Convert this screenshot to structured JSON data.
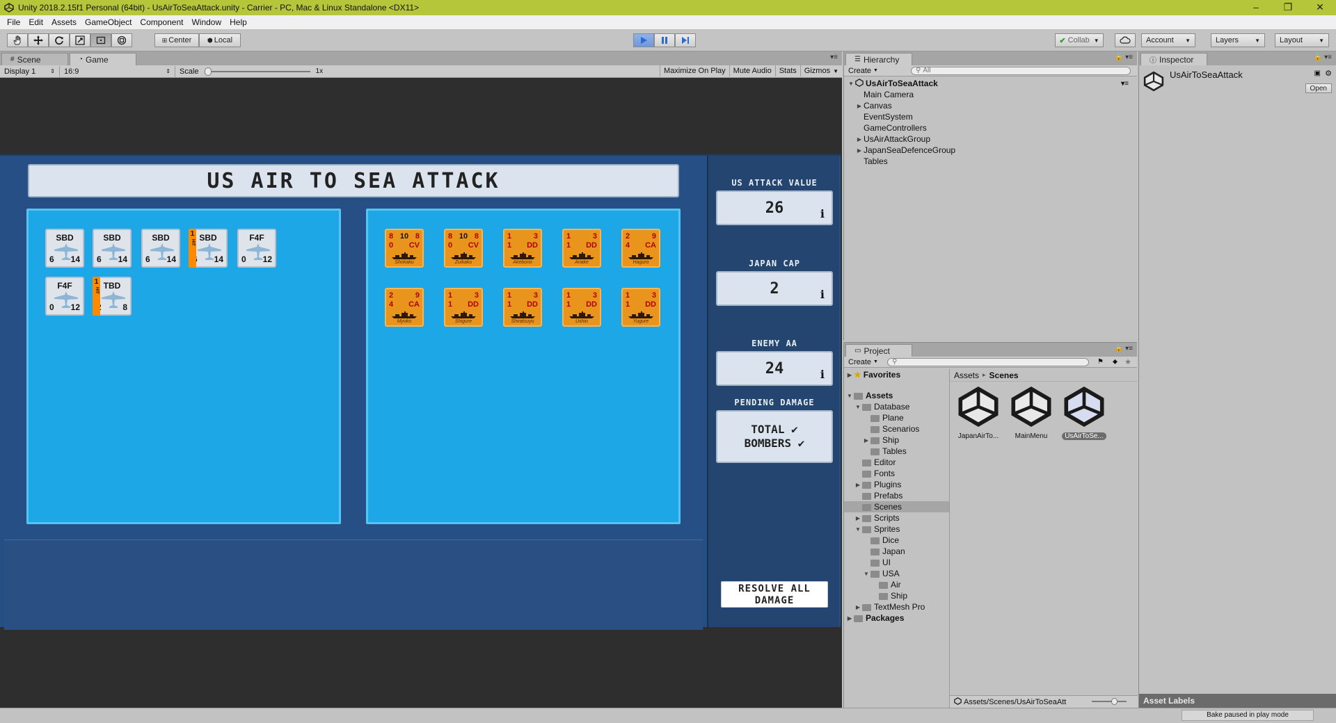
{
  "window": {
    "title": "Unity 2018.2.15f1 Personal (64bit) - UsAirToSeaAttack.unity - Carrier - PC, Mac & Linux Standalone <DX11>",
    "minimize": "–",
    "maximize": "❐",
    "close": "✕"
  },
  "menu": [
    "File",
    "Edit",
    "Assets",
    "GameObject",
    "Component",
    "Window",
    "Help"
  ],
  "toolbar": {
    "pivot": "Center",
    "space": "Local",
    "collab": "Collab",
    "account": "Account",
    "layers": "Layers",
    "layout": "Layout",
    "playing": true
  },
  "scene_tab": "Scene",
  "game_tab": "Game",
  "gamebar": {
    "display": "Display 1",
    "aspect": "16:9",
    "scale_label": "Scale",
    "scale_value": "1x",
    "maximize_on_play": "Maximize On Play",
    "mute_audio": "Mute Audio",
    "stats": "Stats",
    "gizmos": "Gizmos"
  },
  "game": {
    "title": "US AIR TO SEA ATTACK",
    "us_units": [
      {
        "type": "SBD",
        "left": "6",
        "right": "14",
        "hit": ""
      },
      {
        "type": "SBD",
        "left": "6",
        "right": "14",
        "hit": ""
      },
      {
        "type": "SBD",
        "left": "6",
        "right": "14",
        "hit": ""
      },
      {
        "type": "SBD",
        "left": "6",
        "right": "14",
        "hit": "1"
      },
      {
        "type": "F4F",
        "left": "0",
        "right": "12",
        "hit": ""
      },
      {
        "type": "F4F",
        "left": "0",
        "right": "12",
        "hit": ""
      },
      {
        "type": "TBD",
        "left": "2",
        "right": "8",
        "hit": "1"
      }
    ],
    "hit_word": "HIT",
    "japan_units": [
      {
        "a": "8",
        "b": "10",
        "c": "8",
        "d": "0",
        "cls": "CV",
        "name": "Shokaku"
      },
      {
        "a": "8",
        "b": "10",
        "c": "8",
        "d": "0",
        "cls": "CV",
        "name": "Zuikaku"
      },
      {
        "a": "1",
        "b": "",
        "c": "3",
        "d": "1",
        "cls": "DD",
        "name": "Akebono"
      },
      {
        "a": "1",
        "b": "",
        "c": "3",
        "d": "1",
        "cls": "DD",
        "name": "Ariake"
      },
      {
        "a": "2",
        "b": "",
        "c": "9",
        "d": "4",
        "cls": "CA",
        "name": "Haguro"
      },
      {
        "a": "2",
        "b": "",
        "c": "9",
        "d": "4",
        "cls": "CA",
        "name": "Myoko"
      },
      {
        "a": "1",
        "b": "",
        "c": "3",
        "d": "1",
        "cls": "DD",
        "name": "Shigure"
      },
      {
        "a": "1",
        "b": "",
        "c": "3",
        "d": "1",
        "cls": "DD",
        "name": "Shiratsuyu"
      },
      {
        "a": "1",
        "b": "",
        "c": "3",
        "d": "1",
        "cls": "DD",
        "name": "Ushio"
      },
      {
        "a": "1",
        "b": "",
        "c": "3",
        "d": "1",
        "cls": "DD",
        "name": "Yugure"
      }
    ],
    "side": {
      "us_attack_label": "US ATTACK VALUE",
      "us_attack_value": "26",
      "japan_cap_label": "JAPAN CAP",
      "japan_cap_value": "2",
      "enemy_aa_label": "ENEMY AA",
      "enemy_aa_value": "24",
      "pending_label": "PENDING DAMAGE",
      "pending_line1": "TOTAL ✔",
      "pending_line2": "BOMBERS ✔",
      "info_glyph": "i",
      "resolve_line1": "RESOLVE ALL",
      "resolve_line2": "DAMAGE"
    }
  },
  "hierarchy": {
    "tab": "Hierarchy",
    "create": "Create",
    "search_placeholder": "All",
    "scene": "UsAirToSeaAttack",
    "items": [
      {
        "label": "Main Camera",
        "expandable": false
      },
      {
        "label": "Canvas",
        "expandable": true
      },
      {
        "label": "EventSystem",
        "expandable": false
      },
      {
        "label": "GameControllers",
        "expandable": false
      },
      {
        "label": "UsAirAttackGroup",
        "expandable": true
      },
      {
        "label": "JapanSeaDefenceGroup",
        "expandable": true
      },
      {
        "label": "Tables",
        "expandable": false
      }
    ]
  },
  "project": {
    "tab": "Project",
    "create": "Create",
    "favorites": "Favorites",
    "assets_root": "Assets",
    "tree": [
      {
        "label": "Database",
        "depth": 1,
        "tri": "open"
      },
      {
        "label": "Plane",
        "depth": 2,
        "tri": ""
      },
      {
        "label": "Scenarios",
        "depth": 2,
        "tri": ""
      },
      {
        "label": "Ship",
        "depth": 2,
        "tri": "closed"
      },
      {
        "label": "Tables",
        "depth": 2,
        "tri": ""
      },
      {
        "label": "Editor",
        "depth": 1,
        "tri": ""
      },
      {
        "label": "Fonts",
        "depth": 1,
        "tri": ""
      },
      {
        "label": "Plugins",
        "depth": 1,
        "tri": "closed"
      },
      {
        "label": "Prefabs",
        "depth": 1,
        "tri": ""
      },
      {
        "label": "Scenes",
        "depth": 1,
        "tri": "",
        "selected": true
      },
      {
        "label": "Scripts",
        "depth": 1,
        "tri": "closed"
      },
      {
        "label": "Sprites",
        "depth": 1,
        "tri": "open"
      },
      {
        "label": "Dice",
        "depth": 2,
        "tri": ""
      },
      {
        "label": "Japan",
        "depth": 2,
        "tri": ""
      },
      {
        "label": "UI",
        "depth": 2,
        "tri": ""
      },
      {
        "label": "USA",
        "depth": 2,
        "tri": "open"
      },
      {
        "label": "Air",
        "depth": 3,
        "tri": ""
      },
      {
        "label": "Ship",
        "depth": 3,
        "tri": ""
      },
      {
        "label": "TextMesh Pro",
        "depth": 1,
        "tri": "closed"
      }
    ],
    "packages": "Packages",
    "breadcrumb_root": "Assets",
    "breadcrumb_sep": "▸",
    "breadcrumb_current": "Scenes",
    "assets": [
      {
        "label": "JapanAirTo...",
        "selected": false
      },
      {
        "label": "MainMenu",
        "selected": false
      },
      {
        "label": "UsAirToSe...",
        "selected": true
      }
    ],
    "footer_path": "Assets/Scenes/UsAirToSeaAtt"
  },
  "inspector": {
    "tab": "Inspector",
    "object": "UsAirToSeaAttack",
    "open_btn": "Open",
    "asset_labels": "Asset Labels"
  },
  "status": {
    "bake": "Bake paused in play mode"
  },
  "colors": {
    "title_bar": "#b5c63a",
    "game_bg": "#264f86",
    "unit_panel": "#1ea7e7",
    "ship_counter": "#e9941c",
    "hit_tag": "#ff8a00"
  }
}
